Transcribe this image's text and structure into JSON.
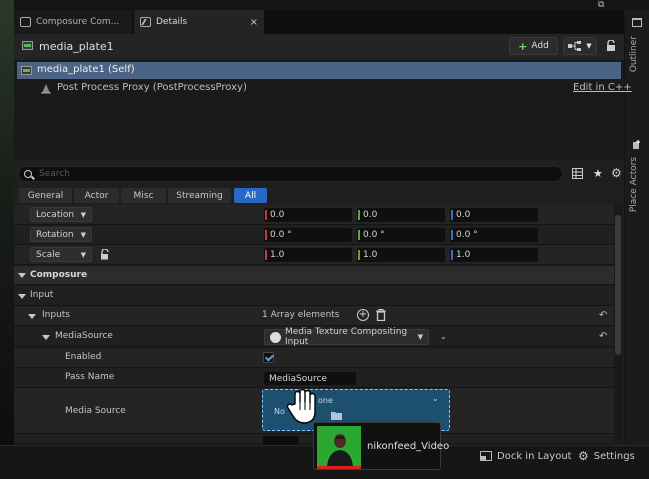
{
  "tabs": [
    {
      "label": "Composure Com...",
      "active": false
    },
    {
      "label": "Details",
      "active": true,
      "close": "×"
    }
  ],
  "window": {
    "restore_glyph": "⧉"
  },
  "right_sidebar": {
    "outliner": "Outliner",
    "place_actors": "Place Actors"
  },
  "header": {
    "actor_name": "media_plate1",
    "add_label": "Add",
    "lock_icon": "lock-icon"
  },
  "components": {
    "self": "media_plate1 (Self)",
    "child": "Post Process Proxy (PostProcessProxy)",
    "edit_link": "Edit in C++"
  },
  "search": {
    "placeholder": "Search"
  },
  "filter_tabs": [
    {
      "label": "General",
      "active": false
    },
    {
      "label": "Actor",
      "active": false
    },
    {
      "label": "Misc",
      "active": false
    },
    {
      "label": "Streaming",
      "active": false
    },
    {
      "label": "All",
      "active": true
    }
  ],
  "transform": {
    "location": {
      "label": "Location",
      "x": "0.0",
      "y": "0.0",
      "z": "0.0"
    },
    "rotation": {
      "label": "Rotation",
      "x": "0.0 °",
      "y": "0.0 °",
      "z": "0.0 °"
    },
    "scale": {
      "label": "Scale",
      "x": "1.0",
      "y": "1.0",
      "z": "1.0"
    }
  },
  "categories": {
    "composure": "Composure",
    "input": "Input"
  },
  "inputs": {
    "label": "Inputs",
    "count_text": "1 Array elements",
    "media_source_group": "MediaSource",
    "media_source_type": "Media Texture Compositing Input",
    "enabled_label": "Enabled",
    "enabled": true,
    "pass_name_label": "Pass Name",
    "pass_name_value": "MediaSource",
    "media_source_label": "Media Source",
    "media_source_none": "one",
    "media_source_no": "No"
  },
  "drag": {
    "asset_name": "nikonfeed_Video"
  },
  "bottom": {
    "dock_label": "Dock in Layout",
    "settings_label": "Settings"
  },
  "colors": {
    "accent": "#2a68c8",
    "selection": "#4b6384",
    "x_axis": "#c23a3a",
    "y_axis": "#62a83a",
    "z_axis": "#3a6fc2"
  }
}
